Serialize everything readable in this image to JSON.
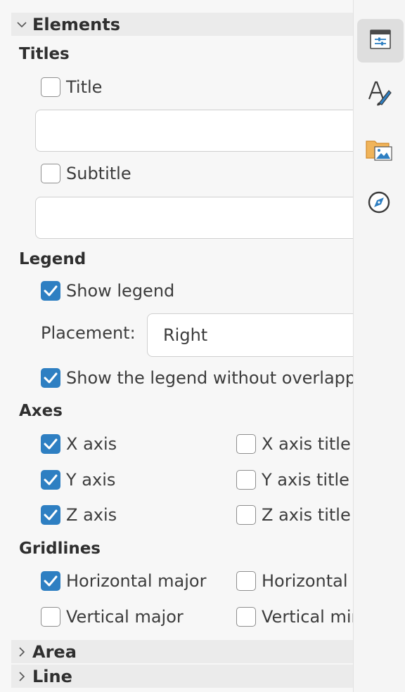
{
  "sections": {
    "elements": "Elements",
    "area": "Area",
    "line": "Line"
  },
  "titles": {
    "heading": "Titles",
    "title_label": "Title",
    "title_checked": false,
    "title_value": "",
    "subtitle_label": "Subtitle",
    "subtitle_checked": false,
    "subtitle_value": ""
  },
  "legend": {
    "heading": "Legend",
    "show_label": "Show legend",
    "show_checked": true,
    "placement_label": "Placement:",
    "placement_value": "Right",
    "no_overlap_label": "Show the legend without overlapping the chart",
    "no_overlap_checked": true
  },
  "axes": {
    "heading": "Axes",
    "x_label": "X axis",
    "x_checked": true,
    "x_title_label": "X axis title",
    "x_title_checked": false,
    "y_label": "Y axis",
    "y_checked": true,
    "y_title_label": "Y axis title",
    "y_title_checked": false,
    "z_label": "Z axis",
    "z_checked": true,
    "z_title_label": "Z axis title",
    "z_title_checked": false
  },
  "gridlines": {
    "heading": "Gridlines",
    "h_major_label": "Horizontal major",
    "h_major_checked": true,
    "h_minor_label": "Horizontal minor",
    "h_minor_checked": false,
    "v_major_label": "Vertical major",
    "v_major_checked": false,
    "v_minor_label": "Vertical minor",
    "v_minor_checked": false
  },
  "tabs": [
    {
      "icon": "properties-icon",
      "active": true
    },
    {
      "icon": "styles-icon",
      "active": false
    },
    {
      "icon": "gallery-icon",
      "active": false
    },
    {
      "icon": "navigator-icon",
      "active": false
    }
  ],
  "colors": {
    "accent": "#2e7fc2"
  }
}
